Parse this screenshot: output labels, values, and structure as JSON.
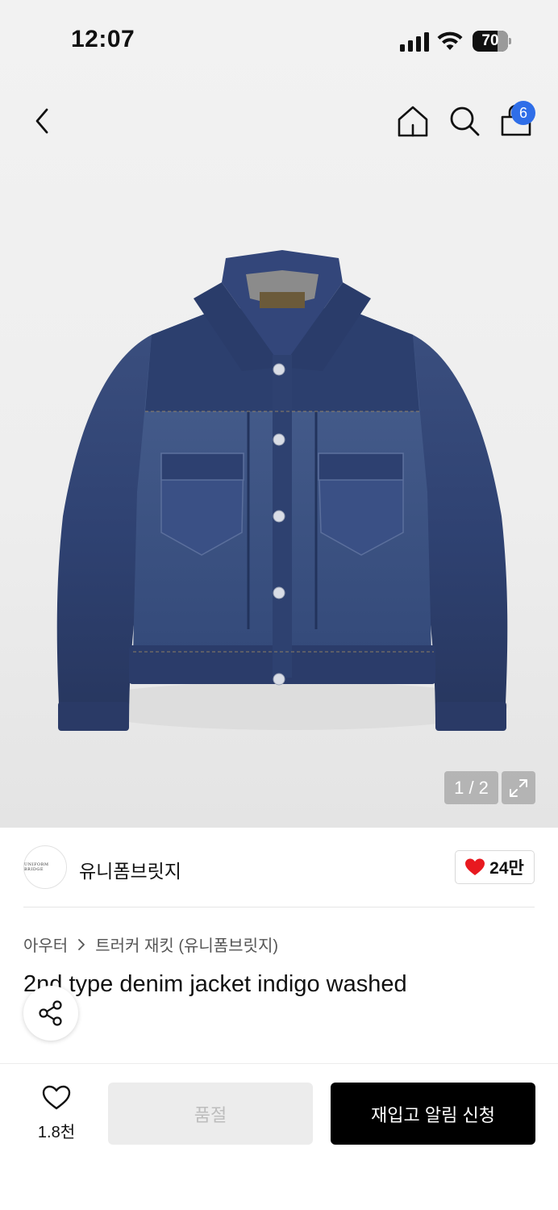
{
  "status_bar": {
    "time": "12:07",
    "battery": "70"
  },
  "nav": {
    "cart_count": "6",
    "icons": [
      "back-arrow-icon",
      "home-icon",
      "search-icon",
      "shopping-bag-icon"
    ]
  },
  "gallery": {
    "counter": "1 / 2",
    "image_subject": "denim-jacket-image"
  },
  "brand": {
    "name": "유니폼브릿지",
    "logo_text": "UNIFORM BRIDGE",
    "likes": "24만"
  },
  "breadcrumb": {
    "category": "아우터",
    "subcategory": "트러커 재킷 (유니폼브릿지)"
  },
  "product": {
    "title": "2nd type denim jacket indigo washed"
  },
  "bottom_bar": {
    "wish_count": "1.8천",
    "soldout_label": "품절",
    "restock_label": "재입고 알림 신청"
  },
  "colors": {
    "accent_blue": "#2f6ee8",
    "heart_red": "#e8191f",
    "primary_black": "#000000",
    "disabled_bg": "#ececec"
  }
}
